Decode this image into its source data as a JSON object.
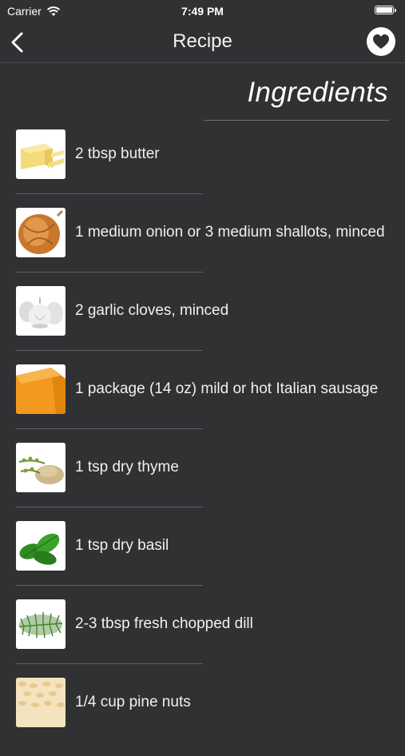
{
  "status_bar": {
    "carrier": "Carrier",
    "time": "7:49 PM"
  },
  "nav": {
    "title": "Recipe",
    "back_icon": "chevron-left-icon",
    "favorite_icon": "heart-icon"
  },
  "section": {
    "title": "Ingredients"
  },
  "ingredients": [
    {
      "text": "2 tbsp butter",
      "image": "butter"
    },
    {
      "text": "1 medium onion or 3 medium shallots, minced",
      "image": "onion"
    },
    {
      "text": "2 garlic cloves, minced",
      "image": "garlic"
    },
    {
      "text": "1 package (14 oz) mild or hot Italian sausage",
      "image": "cheese-wedge"
    },
    {
      "text": "1 tsp dry thyme",
      "image": "thyme"
    },
    {
      "text": "1 tsp dry basil",
      "image": "basil"
    },
    {
      "text": "2-3 tbsp fresh chopped dill",
      "image": "dill"
    },
    {
      "text": "1/4 cup pine nuts",
      "image": "pine-nuts"
    }
  ],
  "colors": {
    "background": "#2f3133",
    "text": "#ffffff",
    "divider": "#5d5f62"
  }
}
